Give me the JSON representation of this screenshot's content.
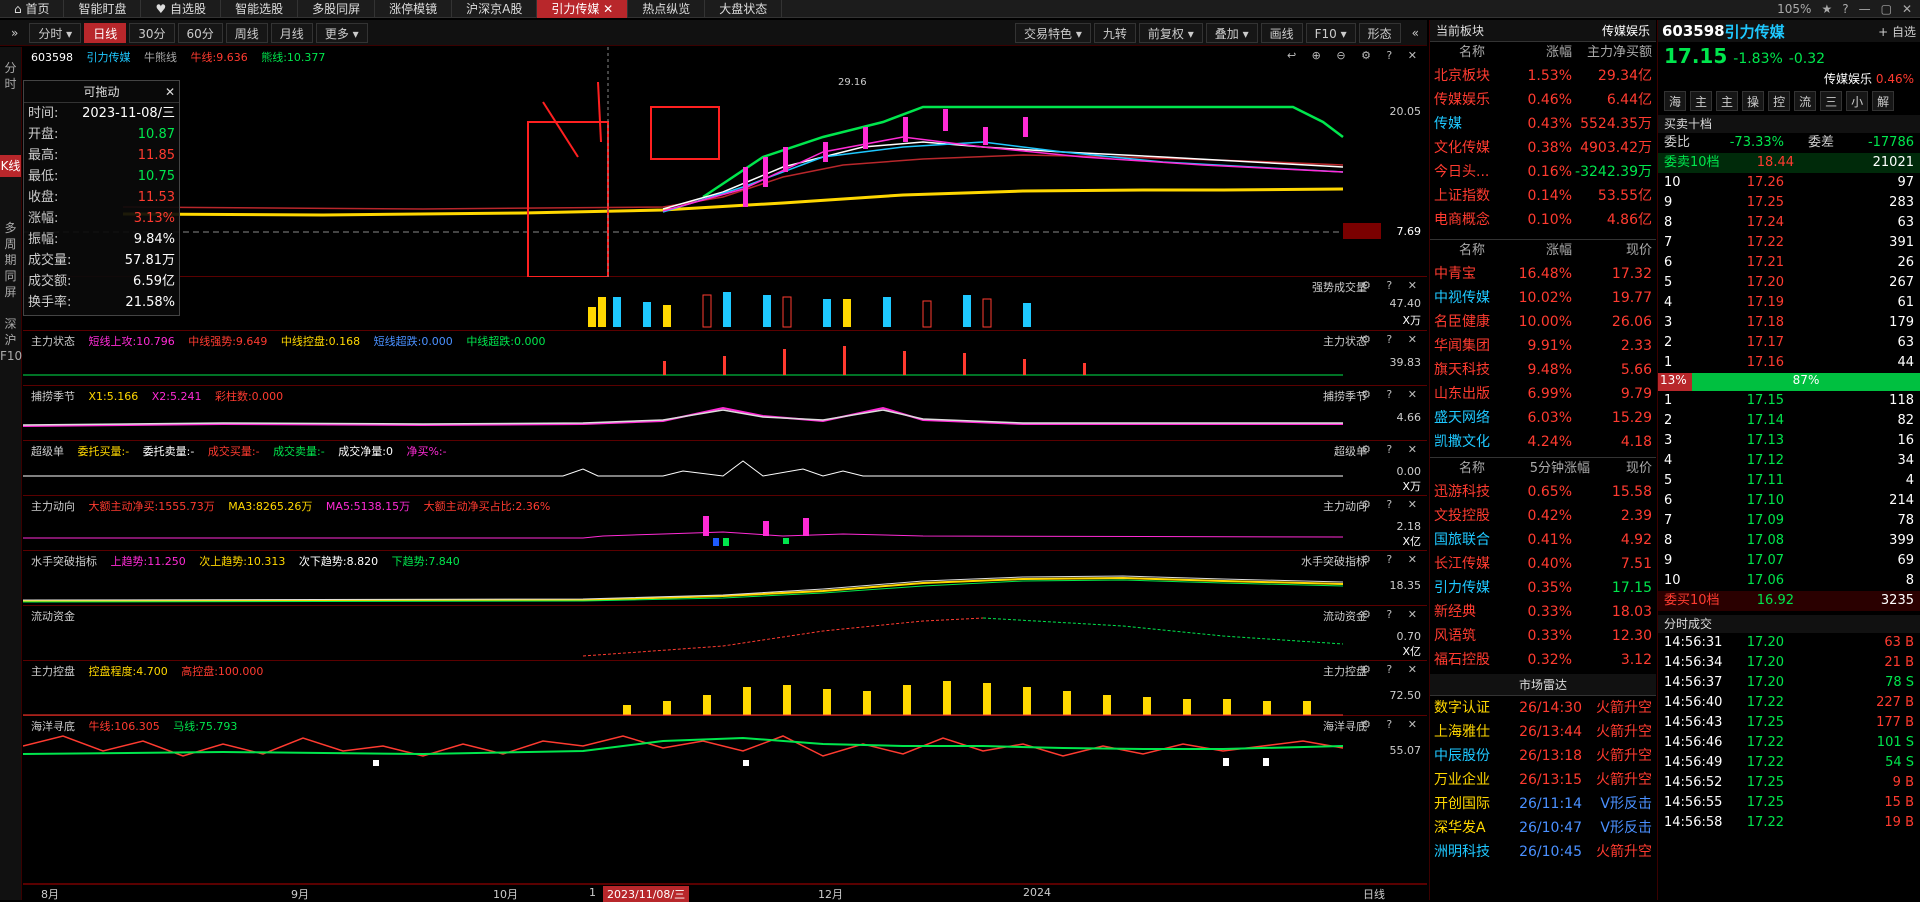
{
  "topbar": {
    "tabs": [
      "首页",
      "智能盯盘",
      "自选股",
      "智能选股",
      "多股同屏",
      "涨停模镜",
      "沪深京A股",
      "引力传媒",
      "热点纵览",
      "大盘状态"
    ],
    "active": "引力传媒",
    "zoom": "105%"
  },
  "toolbar": {
    "left": [
      "分时",
      "日线",
      "30分",
      "60分",
      "周线",
      "月线",
      "更多"
    ],
    "active": "日线",
    "right": [
      "交易特色",
      "九转",
      "前复权",
      "叠加",
      "画线",
      "F10",
      "形态"
    ]
  },
  "side": {
    "items": [
      "分时",
      "K线",
      "多周期同屏",
      "深沪F10"
    ],
    "active": "K线"
  },
  "stock": {
    "code": "603598",
    "name": "引力传媒",
    "price": "17.15",
    "change_pct": "-1.83%",
    "change": "-0.32",
    "sector": "传媒娱乐",
    "sector_pct": "0.46%"
  },
  "main_panel": {
    "ma_label": "牛熊线",
    "bull": "牛线:9.636",
    "bear": "熊线:10.377",
    "y_high": "20.05",
    "y_mark": "7.69",
    "peak": "29.16"
  },
  "popup": {
    "title": "可拖动",
    "rows": [
      [
        "时间:",
        "2023-11-08/三"
      ],
      [
        "开盘:",
        "10.87"
      ],
      [
        "最高:",
        "11.85"
      ],
      [
        "最低:",
        "10.75"
      ],
      [
        "收盘:",
        "11.53"
      ],
      [
        "涨幅:",
        "3.13%"
      ],
      [
        "振幅:",
        "9.84%"
      ],
      [
        "成交量:",
        "57.81万"
      ],
      [
        "成交额:",
        "6.59亿"
      ],
      [
        "换手率:",
        "21.58%"
      ]
    ]
  },
  "panels": [
    {
      "name": "强势成交量",
      "labels": [],
      "ytop": "47.40",
      "ybot": "X万"
    },
    {
      "name": "主力状态",
      "labels": [
        "短线上攻:10.796",
        "中线强势:9.649",
        "中线控盘:0.168",
        "短线超跌:0.000",
        "中线超跌:0.000"
      ],
      "ytop": "39.83",
      "ybot": ""
    },
    {
      "name": "捕捞季节",
      "labels": [
        "X1:5.166",
        "X2:5.241",
        "彩柱数:0.000"
      ],
      "ytop": "4.66",
      "ybot": ""
    },
    {
      "name": "超级单",
      "labels": [
        "委托买量:-",
        "委托卖量:-",
        "成交买量:-",
        "成交卖量:-",
        "成交净量:0",
        "净买%:-"
      ],
      "ytop": "0.00",
      "ybot": "X万"
    },
    {
      "name": "主力动向",
      "labels": [
        "大额主动净买:1555.73万",
        "MA3:8265.26万",
        "MA5:5138.15万",
        "大额主动净买占比:2.36%"
      ],
      "ytop": "2.18",
      "ybot": "X亿"
    },
    {
      "name": "水手突破指标",
      "labels": [
        "上趋势:11.250",
        "次上趋势:10.313",
        "次下趋势:8.820",
        "下趋势:7.840"
      ],
      "ytop": "18.35",
      "ybot": ""
    },
    {
      "name": "流动资金",
      "labels": [],
      "ytop": "0.70",
      "ybot": "X亿"
    },
    {
      "name": "主力控盘",
      "labels": [
        "控盘程度:4.700",
        "高控盘:100.000"
      ],
      "ytop": "72.50",
      "ybot": ""
    },
    {
      "name": "海洋寻底",
      "labels": [
        "牛线:106.305",
        "马线:75.793"
      ],
      "ytop": "55.07",
      "ybot": ""
    }
  ],
  "xaxis": {
    "labels": [
      "8月",
      "9月",
      "10月",
      "1",
      "2023/11/08/三",
      "12月",
      "2024"
    ],
    "right": "日线"
  },
  "sectors": {
    "title": "当前板块",
    "sector": "传媒娱乐",
    "cols": [
      "名称",
      "涨幅",
      "主力净买额"
    ],
    "rows": [
      [
        "北京板块",
        "1.53%",
        "29.34亿"
      ],
      [
        "传媒娱乐",
        "0.46%",
        "6.44亿"
      ],
      [
        "传媒",
        "0.43%",
        "5524.35万"
      ],
      [
        "文化传媒",
        "0.38%",
        "4903.42万"
      ],
      [
        "今日头...",
        "0.16%",
        "-3242.39万"
      ],
      [
        "上证指数",
        "0.14%",
        "53.55亿"
      ],
      [
        "电商概念",
        "0.10%",
        "4.86亿"
      ]
    ]
  },
  "leaders": {
    "cols": [
      "名称",
      "涨幅",
      "现价"
    ],
    "rows": [
      [
        "中青宝",
        "16.48%",
        "17.32"
      ],
      [
        "中视传媒",
        "10.02%",
        "19.77"
      ],
      [
        "名臣健康",
        "10.00%",
        "26.06"
      ],
      [
        "华闻集团",
        "9.91%",
        "2.33"
      ],
      [
        "旗天科技",
        "9.48%",
        "5.66"
      ],
      [
        "山东出版",
        "6.99%",
        "9.79"
      ],
      [
        "盛天网络",
        "6.03%",
        "15.29"
      ],
      [
        "凯撒文化",
        "4.24%",
        "4.18"
      ]
    ]
  },
  "movers": {
    "cols": [
      "名称",
      "5分钟涨幅",
      "现价"
    ],
    "rows": [
      [
        "迅游科技",
        "0.65%",
        "15.58"
      ],
      [
        "文投控股",
        "0.42%",
        "2.39"
      ],
      [
        "国旅联合",
        "0.41%",
        "4.92"
      ],
      [
        "长江传媒",
        "0.40%",
        "7.51"
      ],
      [
        "引力传媒",
        "0.35%",
        "17.15"
      ],
      [
        "新经典",
        "0.33%",
        "18.03"
      ],
      [
        "风语筑",
        "0.33%",
        "12.30"
      ],
      [
        "福石控股",
        "0.32%",
        "3.12"
      ]
    ]
  },
  "radar": {
    "title": "市场雷达",
    "rows": [
      [
        "数字认证",
        "26/14:30",
        "火箭升空"
      ],
      [
        "上海雅仕",
        "26/13:44",
        "火箭升空"
      ],
      [
        "中辰股份",
        "26/13:18",
        "火箭升空"
      ],
      [
        "万业企业",
        "26/13:15",
        "火箭升空"
      ],
      [
        "开创国际",
        "26/11:14",
        "V形反击"
      ],
      [
        "深华发A",
        "26/10:47",
        "V形反击"
      ],
      [
        "洲明科技",
        "26/10:45",
        "火箭升空"
      ]
    ]
  },
  "orderbook": {
    "title": "买卖十档",
    "weibi": "-73.33%",
    "weicha": "-17786",
    "sell_label": "委卖10档",
    "sell_price": "18.44",
    "sell_vol": "21021",
    "asks": [
      [
        "10",
        "17.26",
        "97"
      ],
      [
        "9",
        "17.25",
        "283"
      ],
      [
        "8",
        "17.24",
        "63"
      ],
      [
        "7",
        "17.22",
        "391"
      ],
      [
        "6",
        "17.21",
        "26"
      ],
      [
        "5",
        "17.20",
        "267"
      ],
      [
        "4",
        "17.19",
        "61"
      ],
      [
        "3",
        "17.18",
        "179"
      ],
      [
        "2",
        "17.17",
        "63"
      ],
      [
        "1",
        "17.16",
        "44"
      ]
    ],
    "ratio_left": "13%",
    "ratio_right": "87%",
    "bids": [
      [
        "1",
        "17.15",
        "118"
      ],
      [
        "2",
        "17.14",
        "82"
      ],
      [
        "3",
        "17.13",
        "16"
      ],
      [
        "4",
        "17.12",
        "34"
      ],
      [
        "5",
        "17.11",
        "4"
      ],
      [
        "6",
        "17.10",
        "214"
      ],
      [
        "7",
        "17.09",
        "78"
      ],
      [
        "8",
        "17.08",
        "399"
      ],
      [
        "9",
        "17.07",
        "69"
      ],
      [
        "10",
        "17.06",
        "8"
      ]
    ],
    "buy_label": "委买10档",
    "buy_price": "16.92",
    "buy_vol": "3235"
  },
  "trades": {
    "title": "分时成交",
    "rows": [
      [
        "14:56:31",
        "17.20",
        "63 B"
      ],
      [
        "14:56:34",
        "17.20",
        "21 B"
      ],
      [
        "14:56:37",
        "17.20",
        "78 S"
      ],
      [
        "14:56:40",
        "17.22",
        "227 B"
      ],
      [
        "14:56:43",
        "17.25",
        "177 B"
      ],
      [
        "14:56:46",
        "17.22",
        "101 S"
      ],
      [
        "14:56:49",
        "17.22",
        "54 S"
      ],
      [
        "14:56:52",
        "17.25",
        "9 B"
      ],
      [
        "14:56:55",
        "17.25",
        "15 B"
      ],
      [
        "14:56:58",
        "17.22",
        "19 B"
      ]
    ]
  }
}
